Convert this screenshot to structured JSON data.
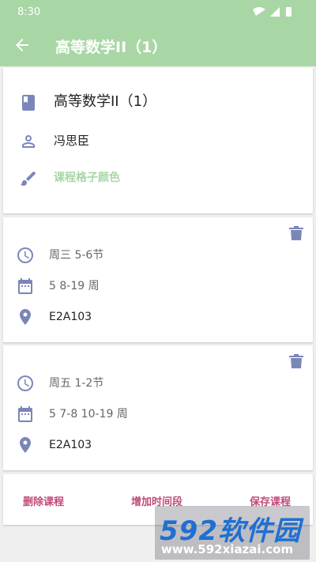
{
  "status_bar": {
    "time": "8:30"
  },
  "app_bar": {
    "title": "高等数学II（1）"
  },
  "course": {
    "name": "高等数学II（1）",
    "teacher": "冯思臣",
    "color_label": "课程格子颜色"
  },
  "periods": [
    {
      "time": "周三 5-6节",
      "weeks": "5 8-19 周",
      "room": "E2A103"
    },
    {
      "time": "周五 1-2节",
      "weeks": "5 7-8 10-19 周",
      "room": "E2A103"
    }
  ],
  "actions": {
    "delete": "删除课程",
    "add_period": "增加时间段",
    "save": "保存课程"
  },
  "watermark": {
    "brand": "592软件园",
    "url": "www.592xiazai.com"
  },
  "colors": {
    "primary": "#a8d7a5",
    "icon": "#7b86b8",
    "action": "#c14a7a"
  }
}
